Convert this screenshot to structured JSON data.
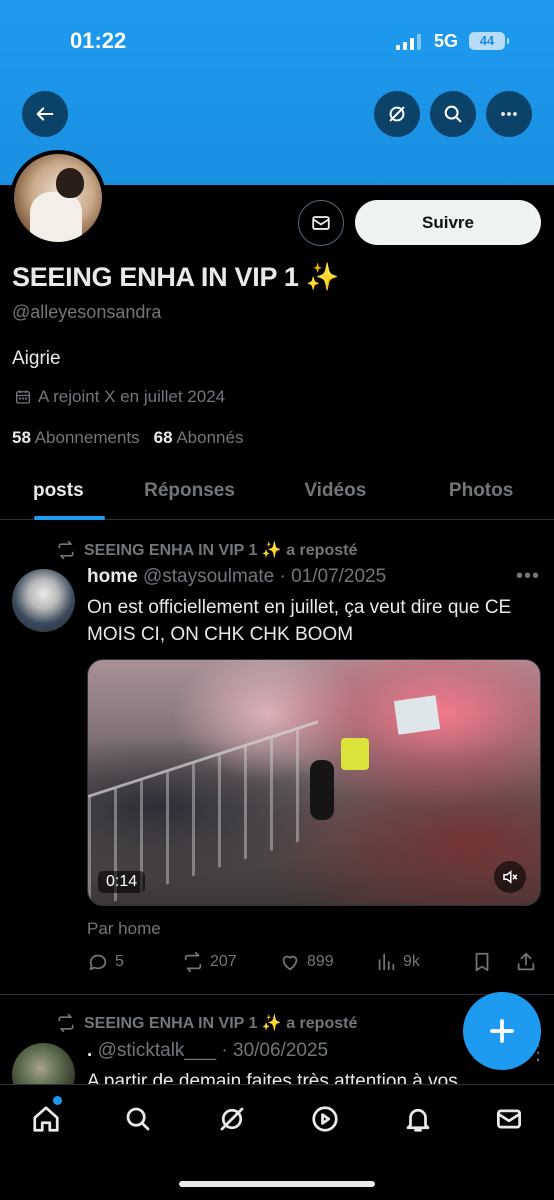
{
  "status_bar": {
    "time": "01:22",
    "network": "5G",
    "battery": "44"
  },
  "header": {
    "back_icon": "arrow-left-icon",
    "grok_icon": "grok-icon",
    "search_icon": "search-icon",
    "more_icon": "more-horizontal-icon"
  },
  "profile": {
    "display_name": "SEEING ENHA IN VIP 1 ✨",
    "handle": "@alleyesonsandra",
    "bio": "Aigrie",
    "joined": "A rejoint X en juillet 2024",
    "following_count": "58",
    "following_label": "Abonnements",
    "followers_count": "68",
    "followers_label": "Abonnés",
    "follow_button": "Suivre",
    "message_icon": "envelope-icon"
  },
  "tabs": [
    {
      "label": "posts",
      "active": true
    },
    {
      "label": "Réponses",
      "active": false
    },
    {
      "label": "Vidéos",
      "active": false
    },
    {
      "label": "Photos",
      "active": false
    }
  ],
  "posts": [
    {
      "repost_label": "SEEING ENHA IN VIP 1 ✨ a reposté",
      "author": "home",
      "handle": "@staysoulmate",
      "date": "· 01/07/2025",
      "text": "On est officiellement en juillet, ça veut dire que CE MOIS CI, ON CHK CHK BOOM",
      "media_duration": "0:14",
      "by_line": "Par home",
      "replies": "5",
      "reposts": "207",
      "likes": "899",
      "views": "9k"
    },
    {
      "repost_label": "SEEING ENHA IN VIP 1 ✨ a reposté",
      "author": ".",
      "handle": "@sticktalk___",
      "date": "· 30/06/2025",
      "text": "A partir de demain faites très attention à vos"
    }
  ],
  "fab_icon": "compose-plus-icon",
  "bottom_nav": [
    "home-icon",
    "search-icon",
    "grok-icon",
    "video-icon",
    "bell-icon",
    "mail-icon"
  ],
  "colors": {
    "accent": "#1d9bf0",
    "background": "#000000",
    "muted": "#71767b",
    "text": "#e7e9ea"
  }
}
